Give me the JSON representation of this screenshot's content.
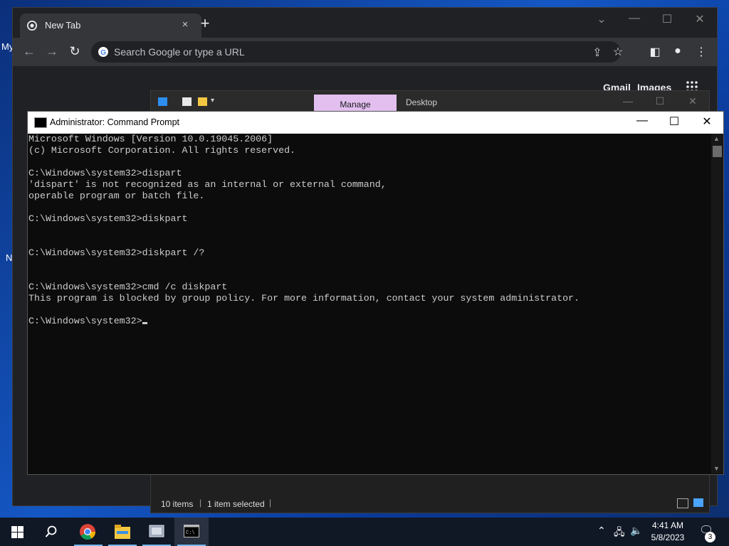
{
  "desktop": {
    "edge_letters": [
      "My",
      "N"
    ]
  },
  "chrome": {
    "tab_title": "New Tab",
    "tab_close": "×",
    "new_tab": "+",
    "omnibox_placeholder": "Search Google or type a URL",
    "links": {
      "gmail": "Gmail",
      "images": "Images"
    },
    "window_controls": {
      "minimize": "—",
      "maximize": "☐",
      "close": "✕",
      "tab_search": "⌄"
    }
  },
  "explorer": {
    "tab_manage": "Manage",
    "tab_desktop": "Desktop",
    "status_items": "10 items",
    "status_selected": "1 item selected",
    "window_controls": {
      "minimize": "—",
      "maximize": "☐",
      "close": "✕"
    }
  },
  "cmd": {
    "title": "Administrator: Command Prompt",
    "window_controls": {
      "minimize": "—",
      "maximize": "☐",
      "close": "✕"
    },
    "lines": [
      "Microsoft Windows [Version 10.0.19045.2006]",
      "(c) Microsoft Corporation. All rights reserved.",
      "",
      "C:\\Windows\\system32>dispart",
      "'dispart' is not recognized as an internal or external command,",
      "operable program or batch file.",
      "",
      "C:\\Windows\\system32>diskpart",
      "",
      "",
      "C:\\Windows\\system32>diskpart /?",
      "",
      "",
      "C:\\Windows\\system32>cmd /c diskpart",
      "This program is blocked by group policy. For more information, contact your system administrator.",
      "",
      "C:\\Windows\\system32>"
    ]
  },
  "taskbar": {
    "apps": [
      "start-icon",
      "search-icon",
      "chrome-icon",
      "file-explorer-icon",
      "control-panel-icon",
      "command-prompt-icon"
    ],
    "clock_time": "4:41 AM",
    "clock_date": "5/8/2023",
    "notification_count": "3"
  },
  "colors": {
    "chrome_bg": "#202124",
    "cmd_bg": "#0c0c0c",
    "manage_tab": "#e3bff0",
    "taskbar": "#101826"
  }
}
